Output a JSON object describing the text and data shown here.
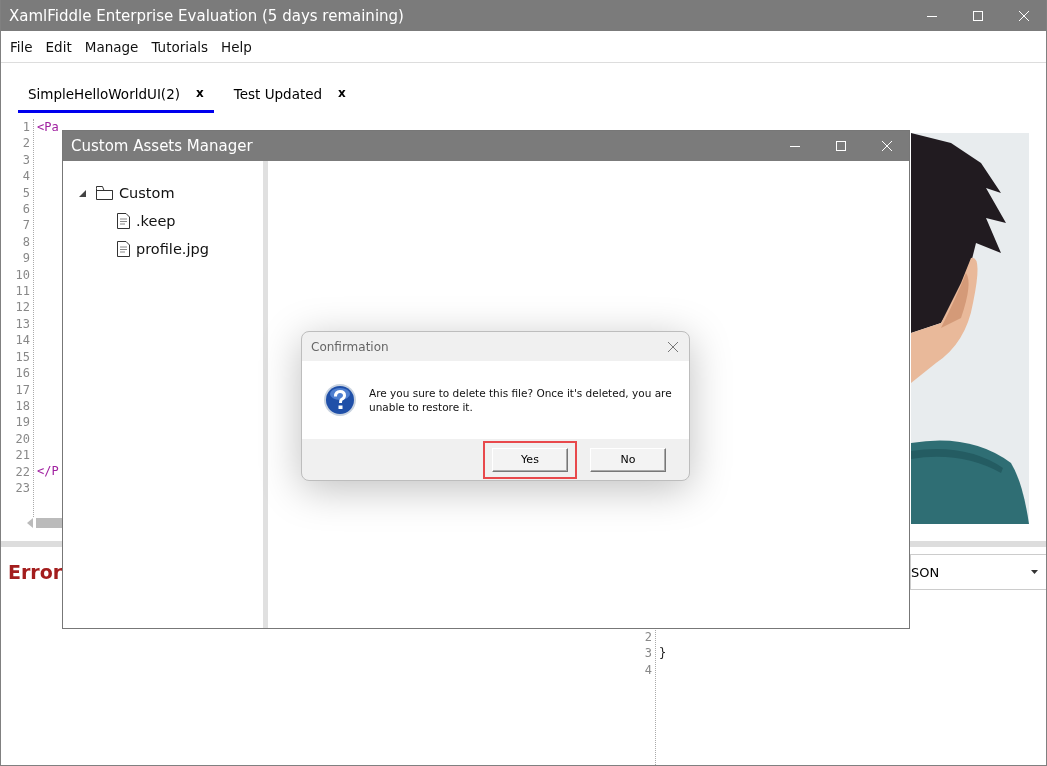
{
  "window": {
    "title": "XamlFiddle Enterprise Evaluation (5 days remaining)"
  },
  "menu": [
    "File",
    "Edit",
    "Manage",
    "Tutorials",
    "Help"
  ],
  "tabs": [
    {
      "label": "SimpleHelloWorldUI(2)",
      "close": "x",
      "selected": true
    },
    {
      "label": "Test Updated",
      "close": "x",
      "selected": false
    }
  ],
  "code_editor": {
    "lines": [
      {
        "number": "1",
        "code": "<Pa"
      },
      {
        "number": "2"
      },
      {
        "number": "3"
      },
      {
        "number": "4"
      },
      {
        "number": "5"
      },
      {
        "number": "6"
      },
      {
        "number": "7"
      },
      {
        "number": "8"
      },
      {
        "number": "9"
      },
      {
        "number": "10"
      },
      {
        "number": "11"
      },
      {
        "number": "12"
      },
      {
        "number": "13"
      },
      {
        "number": "14"
      },
      {
        "number": "15"
      },
      {
        "number": "16"
      },
      {
        "number": "17"
      },
      {
        "number": "18"
      },
      {
        "number": "19"
      },
      {
        "number": "20"
      },
      {
        "number": "21"
      },
      {
        "number": "22",
        "code": "</P"
      },
      {
        "number": "23"
      }
    ]
  },
  "error_panel": {
    "title": "Error",
    "format_dropdown": {
      "value": "SON"
    },
    "output_lines": [
      {
        "number": "2"
      },
      {
        "number": "3",
        "code": "}"
      },
      {
        "number": "4"
      }
    ]
  },
  "assets_manager": {
    "title": "Custom Assets Manager",
    "tree": [
      {
        "label": "Custom",
        "kind": "folder",
        "expanded": true,
        "children": [
          {
            "label": ".keep",
            "kind": "file"
          },
          {
            "label": "profile.jpg",
            "kind": "file"
          }
        ]
      }
    ]
  },
  "confirmation": {
    "title": "Confirmation",
    "message": "Are you sure to delete this file? Once it's deleted, you are unable to restore it.",
    "buttons": [
      {
        "label": "Yes",
        "highlighted": true
      },
      {
        "label": "No",
        "highlighted": false
      }
    ]
  }
}
